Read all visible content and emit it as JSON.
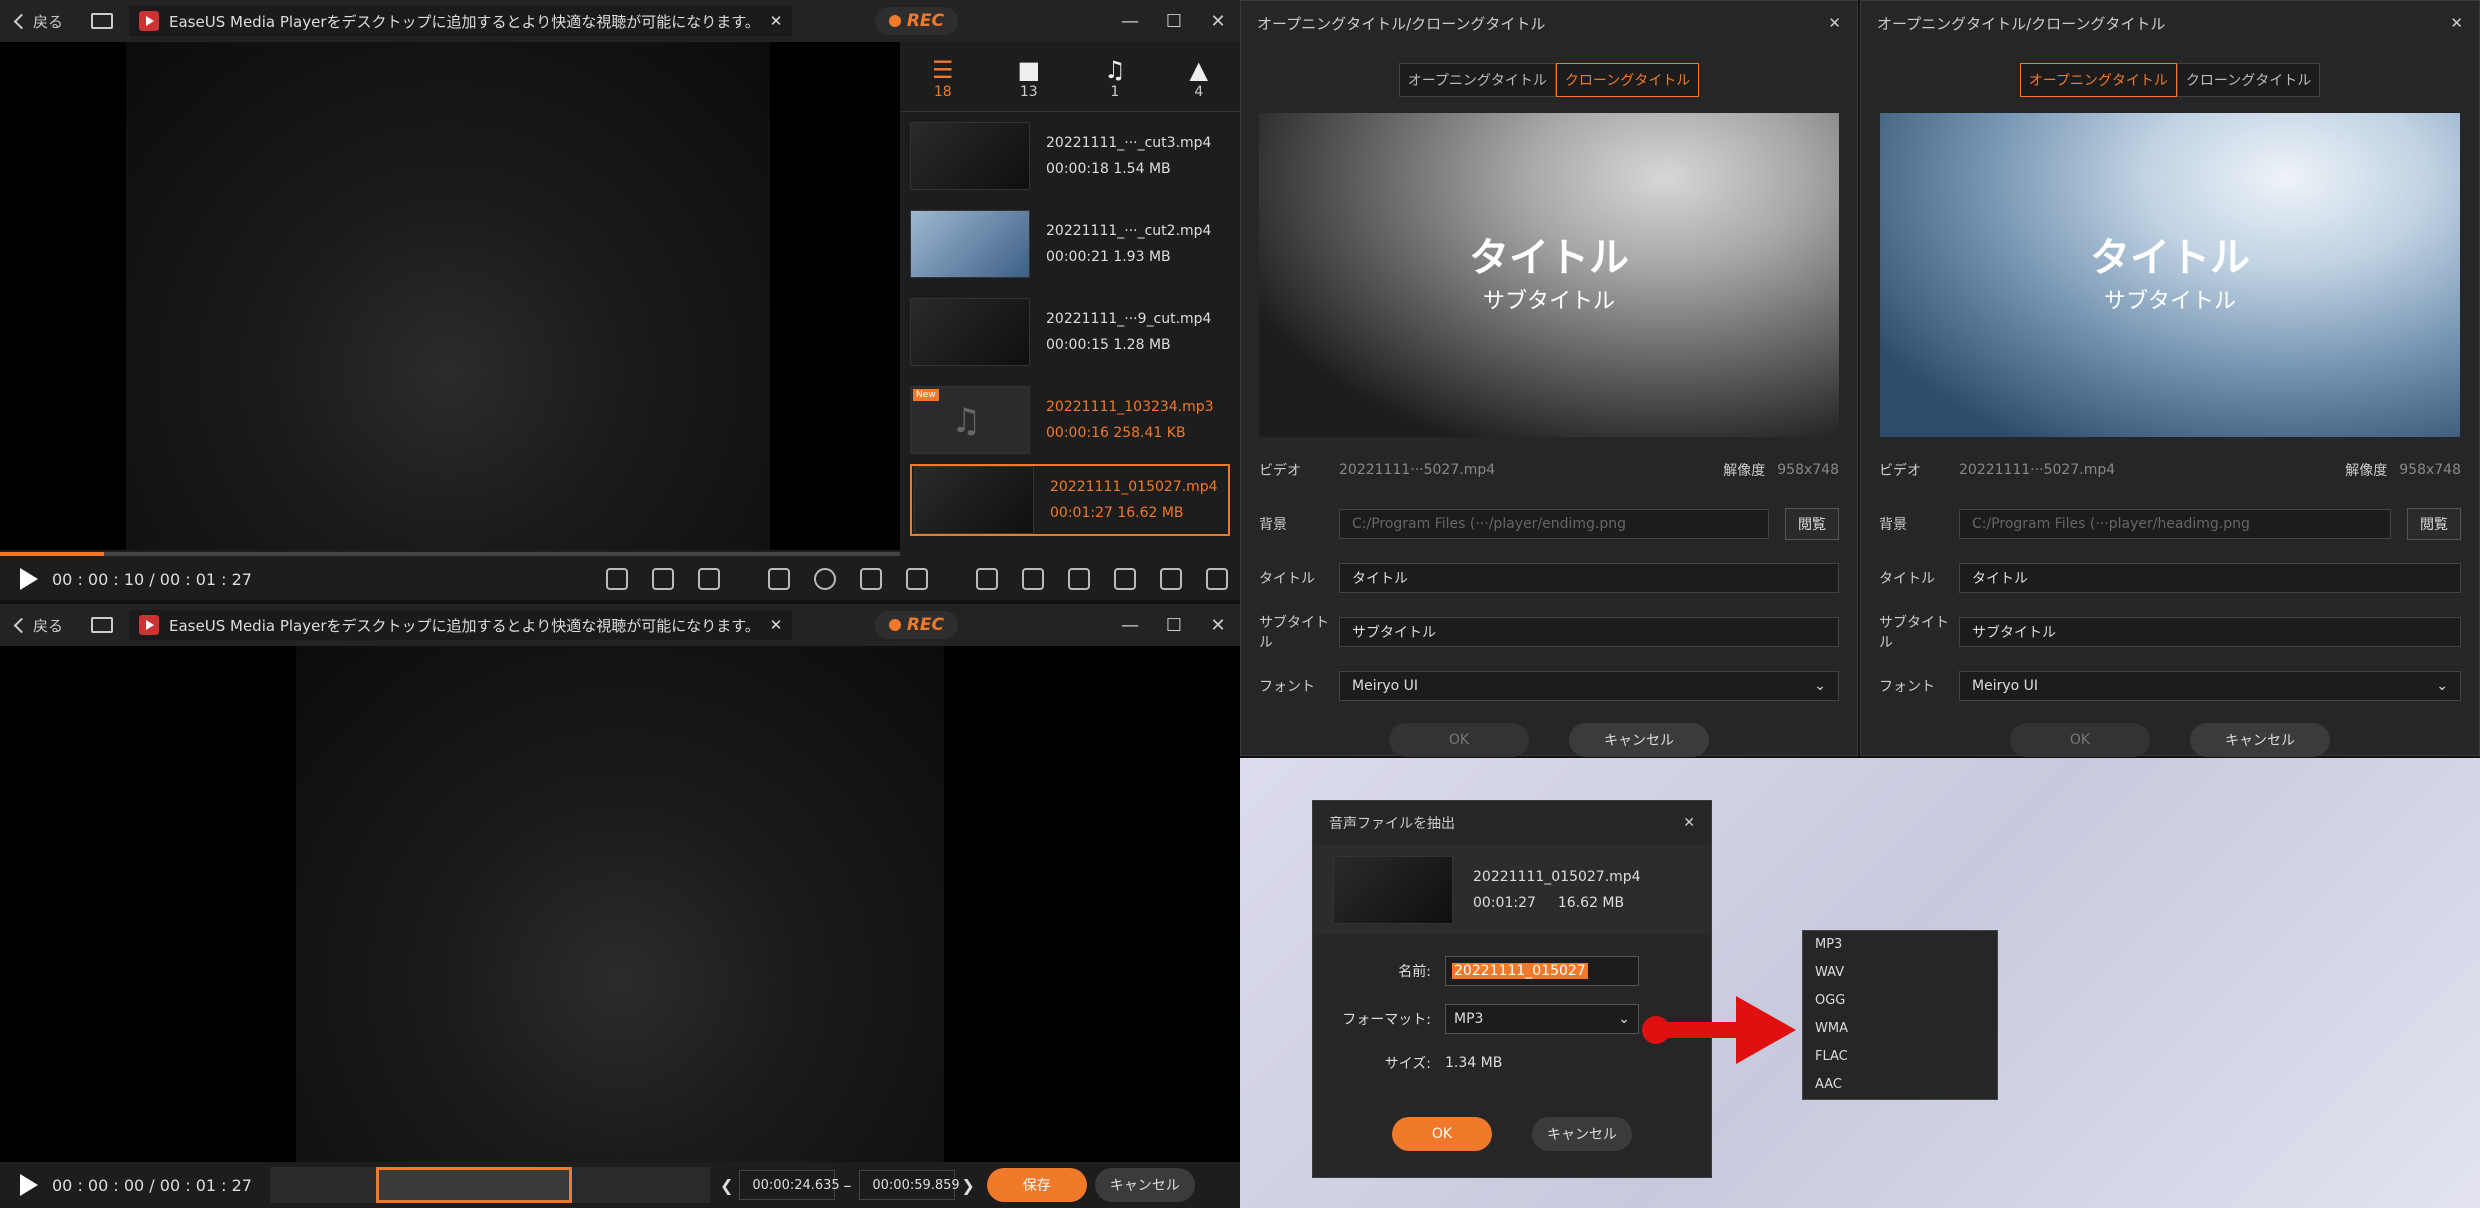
{
  "player_top": {
    "back_label": "戻る",
    "notice": "EaseUS Media Playerをデスクトップに追加するとより快適な視聴が可能になります。",
    "rec": "REC",
    "time": "00 : 00 : 10 / 00 : 01 : 27",
    "progress": 0.115
  },
  "player_bottom": {
    "back_label": "戻る",
    "notice": "EaseUS Media Playerをデスクトップに追加するとより快適な視聴が可能になります。",
    "rec": "REC",
    "time": "00 : 00 : 00 / 00 : 01 : 27",
    "start": "00:00:24.635",
    "end": "00:00:59.859",
    "dash": "–",
    "save": "保存",
    "cancel": "キャンセル"
  },
  "sidebar": {
    "tabs": [
      {
        "icon": "list-icon",
        "count": "18"
      },
      {
        "icon": "video-icon",
        "count": "13"
      },
      {
        "icon": "music-icon",
        "count": "1"
      },
      {
        "icon": "image-icon",
        "count": "4"
      }
    ],
    "items": [
      {
        "name": "20221111_···_cut3.mp4",
        "meta": "00:00:18   1.54 MB"
      },
      {
        "name": "20221111_···_cut2.mp4",
        "meta": "00:00:21   1.93 MB"
      },
      {
        "name": "20221111_···9_cut.mp4",
        "meta": "00:00:15   1.28 MB"
      },
      {
        "name": "20221111_103234.mp3",
        "meta": "00:00:16   258.41 KB",
        "badge": "New"
      },
      {
        "name": "20221111_015027.mp4",
        "meta": "00:01:27   16.62 MB"
      }
    ]
  },
  "dialog_left": {
    "title": "オープニングタイトル/クローングタイトル",
    "tab1": "オープニングタイトル",
    "tab2": "クローングタイトル",
    "preview_title": "タイトル",
    "preview_sub": "サブタイトル",
    "video_label": "ビデオ",
    "video_value": "20221111···5027.mp4",
    "res_label": "解像度",
    "res_value": "958x748",
    "bg_label": "背景",
    "bg_value": "C:/Program Files (···/player/endimg.png",
    "browse": "閲覧",
    "title_label": "タイトル",
    "title_value": "タイトル",
    "sub_label": "サブタイトル",
    "sub_value": "サブタイトル",
    "font_label": "フォント",
    "font_value": "Meiryo UI",
    "ok": "OK",
    "cancel": "キャンセル"
  },
  "dialog_right": {
    "title": "オープニングタイトル/クローングタイトル",
    "tab1": "オープニングタイトル",
    "tab2": "クローングタイトル",
    "preview_title": "タイトル",
    "preview_sub": "サブタイトル",
    "video_label": "ビデオ",
    "video_value": "20221111···5027.mp4",
    "res_label": "解像度",
    "res_value": "958x748",
    "bg_label": "背景",
    "bg_value": "C:/Program Files (···player/headimg.png",
    "browse": "閲覧",
    "title_label": "タイトル",
    "title_value": "タイトル",
    "sub_label": "サブタイトル",
    "sub_value": "サブタイトル",
    "font_label": "フォント",
    "font_value": "Meiryo UI",
    "ok": "OK",
    "cancel": "キャンセル"
  },
  "extract": {
    "title": "音声ファイルを抽出",
    "file": "20221111_015027.mp4",
    "duration": "00:01:27",
    "size": "16.62 MB",
    "name_label": "名前:",
    "name_value": "20221111_015027",
    "format_label": "フォーマット:",
    "format_value": "MP3",
    "size_label": "サイズ:",
    "size_value": "1.34 MB",
    "ok": "OK",
    "cancel": "キャンセル",
    "options": [
      "MP3",
      "WAV",
      "OGG",
      "WMA",
      "FLAC",
      "AAC"
    ]
  },
  "colors": {
    "accent": "#f07a2a",
    "arrow": "#e01010"
  }
}
